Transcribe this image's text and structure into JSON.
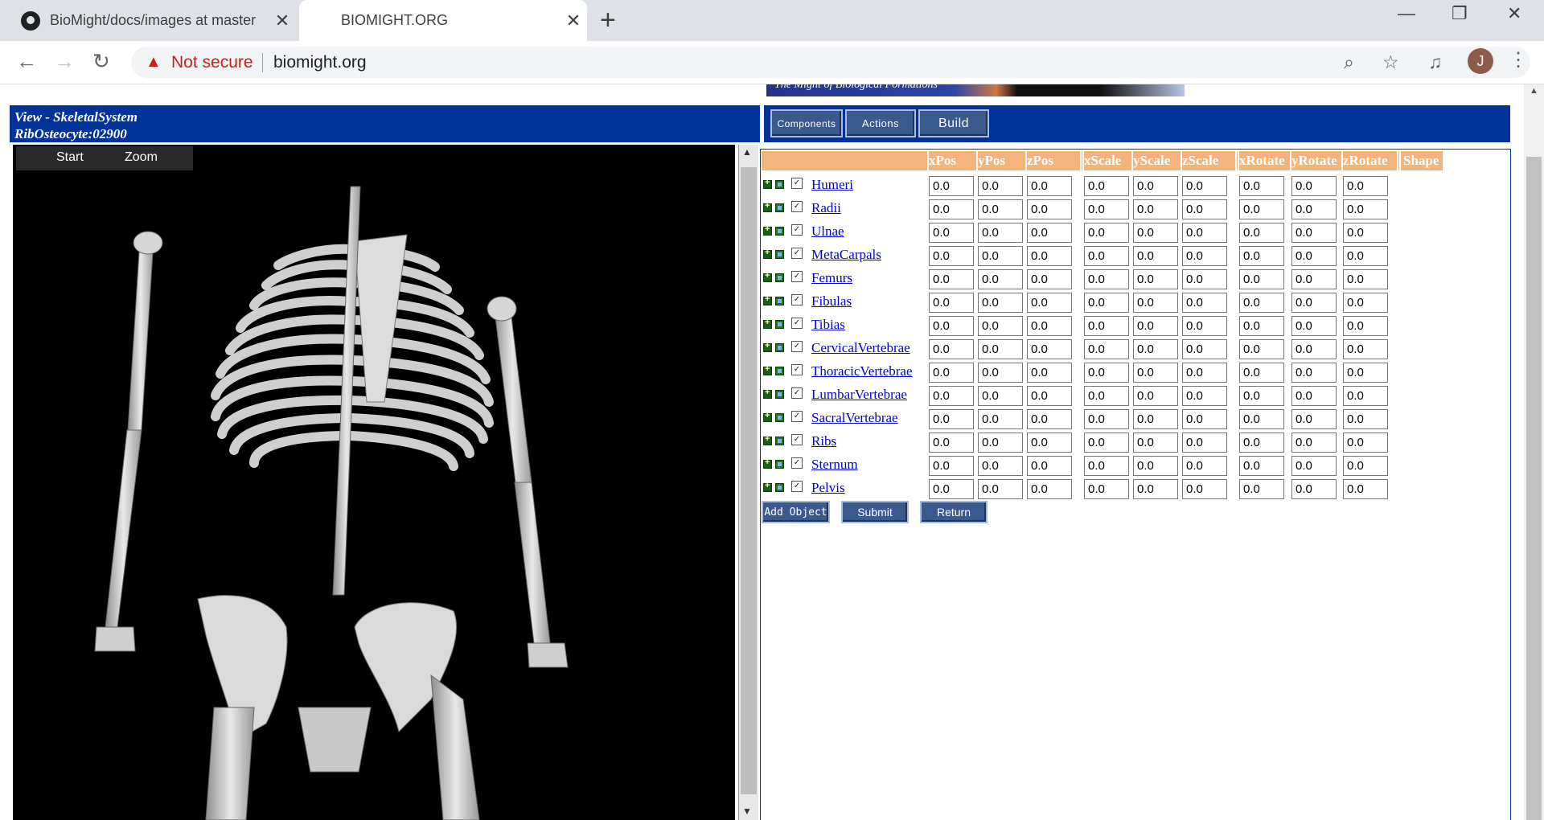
{
  "browser": {
    "tabs": [
      {
        "title": "BioMight/docs/images at master",
        "close": "✕"
      },
      {
        "title": "BIOMIGHT.ORG",
        "close": "✕"
      }
    ],
    "new_tab": "+",
    "window_controls": {
      "minimize": "—",
      "restore": "❐",
      "close": "✕"
    },
    "security": "Not secure",
    "url": "biomight.org",
    "profile_initial": "J"
  },
  "page": {
    "banner_text": "The Might of Biological Formations",
    "view_title": "View - SkeletalSystem",
    "view_subtitle": "RibOsteocyte:02900",
    "top_buttons": {
      "components": "Components",
      "actions": "Actions",
      "build": "Build"
    },
    "viewer_menu": {
      "start": "Start",
      "zoom": "Zoom"
    },
    "columns": [
      "xPos",
      "yPos",
      "zPos",
      "xScale",
      "yScale",
      "zScale",
      "xRotate",
      "yRotate",
      "zRotate",
      "Shape"
    ],
    "rows": [
      {
        "name": "Humeri",
        "values": [
          "0.0",
          "0.0",
          "0.0",
          "0.0",
          "0.0",
          "0.0",
          "0.0",
          "0.0",
          "0.0"
        ]
      },
      {
        "name": "Radii",
        "values": [
          "0.0",
          "0.0",
          "0.0",
          "0.0",
          "0.0",
          "0.0",
          "0.0",
          "0.0",
          "0.0"
        ]
      },
      {
        "name": "Ulnae",
        "values": [
          "0.0",
          "0.0",
          "0.0",
          "0.0",
          "0.0",
          "0.0",
          "0.0",
          "0.0",
          "0.0"
        ]
      },
      {
        "name": "MetaCarpals",
        "values": [
          "0.0",
          "0.0",
          "0.0",
          "0.0",
          "0.0",
          "0.0",
          "0.0",
          "0.0",
          "0.0"
        ]
      },
      {
        "name": "Femurs",
        "values": [
          "0.0",
          "0.0",
          "0.0",
          "0.0",
          "0.0",
          "0.0",
          "0.0",
          "0.0",
          "0.0"
        ]
      },
      {
        "name": "Fibulas",
        "values": [
          "0.0",
          "0.0",
          "0.0",
          "0.0",
          "0.0",
          "0.0",
          "0.0",
          "0.0",
          "0.0"
        ]
      },
      {
        "name": "Tibias",
        "values": [
          "0.0",
          "0.0",
          "0.0",
          "0.0",
          "0.0",
          "0.0",
          "0.0",
          "0.0",
          "0.0"
        ]
      },
      {
        "name": "CervicalVertebrae",
        "values": [
          "0.0",
          "0.0",
          "0.0",
          "0.0",
          "0.0",
          "0.0",
          "0.0",
          "0.0",
          "0.0"
        ]
      },
      {
        "name": "ThoracicVertebrae",
        "values": [
          "0.0",
          "0.0",
          "0.0",
          "0.0",
          "0.0",
          "0.0",
          "0.0",
          "0.0",
          "0.0"
        ]
      },
      {
        "name": "LumbarVertebrae",
        "values": [
          "0.0",
          "0.0",
          "0.0",
          "0.0",
          "0.0",
          "0.0",
          "0.0",
          "0.0",
          "0.0"
        ]
      },
      {
        "name": "SacralVertebrae",
        "values": [
          "0.0",
          "0.0",
          "0.0",
          "0.0",
          "0.0",
          "0.0",
          "0.0",
          "0.0",
          "0.0"
        ]
      },
      {
        "name": "Ribs",
        "values": [
          "0.0",
          "0.0",
          "0.0",
          "0.0",
          "0.0",
          "0.0",
          "0.0",
          "0.0",
          "0.0"
        ]
      },
      {
        "name": "Sternum",
        "values": [
          "0.0",
          "0.0",
          "0.0",
          "0.0",
          "0.0",
          "0.0",
          "0.0",
          "0.0",
          "0.0"
        ]
      },
      {
        "name": "Pelvis",
        "values": [
          "0.0",
          "0.0",
          "0.0",
          "0.0",
          "0.0",
          "0.0",
          "0.0",
          "0.0",
          "0.0"
        ]
      }
    ],
    "bottom_buttons": {
      "add_object": "Add Object",
      "submit": "Submit",
      "return": "Return"
    },
    "colors": {
      "header_blue": "#003399",
      "column_header": "#f3b47b",
      "link": "#0000cc",
      "button": "#3a5a8e"
    }
  }
}
